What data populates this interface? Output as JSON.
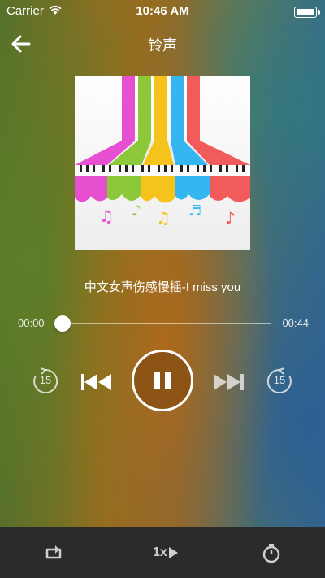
{
  "status_bar": {
    "carrier": "Carrier",
    "time": "10:46 AM"
  },
  "header": {
    "title": "铃声",
    "back_icon": "arrow-left-icon"
  },
  "track": {
    "title": "中文女声伤感慢摇-I miss you",
    "elapsed": "00:00",
    "duration": "00:44",
    "progress": 0
  },
  "controls": {
    "skip_back_label": "15",
    "skip_forward_label": "15",
    "icons": [
      "skip-back-15-icon",
      "previous-icon",
      "pause-icon",
      "next-icon",
      "skip-forward-15-icon"
    ]
  },
  "bottom_bar": {
    "speed_label": "1x",
    "icons": [
      "repeat-icon",
      "play-speed-icon",
      "sleep-timer-icon"
    ]
  },
  "colors": {
    "bottom_bar_bg": "#2b2b2b",
    "play_button_fill": "#8a5214",
    "text": "#ffffff"
  }
}
